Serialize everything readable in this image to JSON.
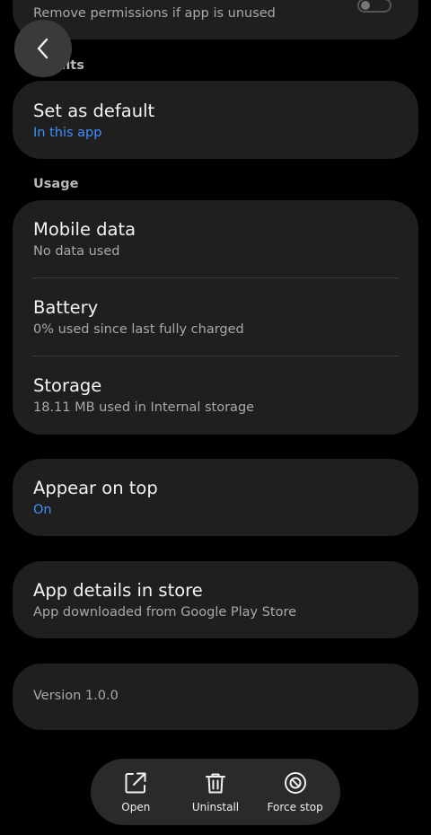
{
  "top_card": {
    "subtitle": "Remove permissions if app is unused"
  },
  "sections": {
    "defaults_label": "ults",
    "usage_label": "Usage"
  },
  "defaults": {
    "title": "Set as default",
    "subtitle": "In this app"
  },
  "usage": {
    "items": [
      {
        "title": "Mobile data",
        "subtitle": "No data used"
      },
      {
        "title": "Battery",
        "subtitle": "0% used since last fully charged"
      },
      {
        "title": "Storage",
        "subtitle": "18.11 MB used in Internal storage"
      }
    ]
  },
  "appear_on_top": {
    "title": "Appear on top",
    "subtitle": "On"
  },
  "store": {
    "title": "App details in store",
    "subtitle": "App downloaded from Google Play Store"
  },
  "version": {
    "text": "Version 1.0.0"
  },
  "bottom_actions": {
    "open": "Open",
    "uninstall": "Uninstall",
    "force_stop": "Force stop"
  },
  "colors": {
    "accent": "#3e91ff",
    "card": "#1f1f1f",
    "background": "#000000"
  },
  "icons": {
    "back": "chevron-left-icon",
    "open": "open-external-icon",
    "uninstall": "trash-icon",
    "force_stop": "block-icon"
  }
}
